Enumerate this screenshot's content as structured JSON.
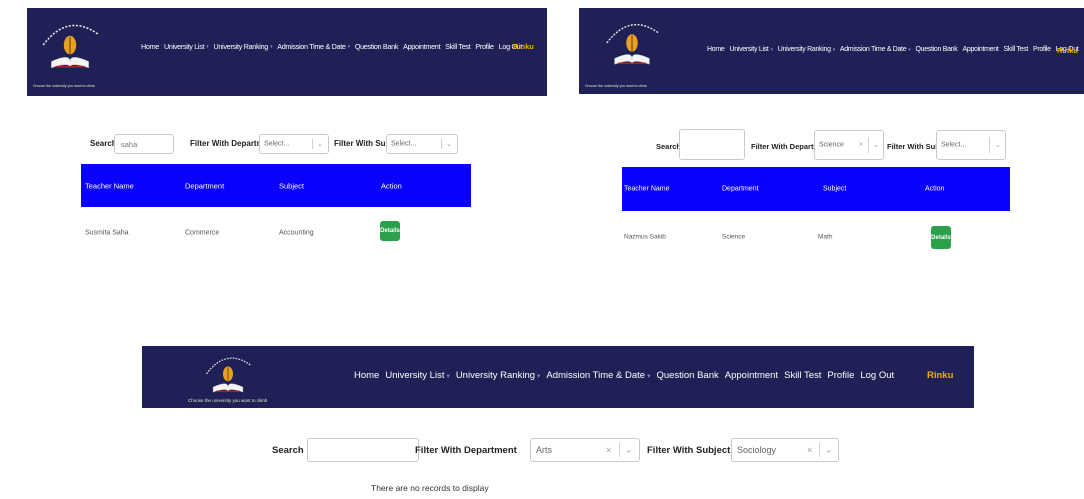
{
  "nav": {
    "tagline": "Choose the university you want to climb",
    "user": "Rinku",
    "menu": [
      {
        "label": "Home",
        "caret": false
      },
      {
        "label": "University List",
        "caret": true
      },
      {
        "label": "University Ranking",
        "caret": true
      },
      {
        "label": "Admission Time & Date",
        "caret": true
      },
      {
        "label": "Question Bank",
        "caret": false
      },
      {
        "label": "Appointment",
        "caret": false
      },
      {
        "label": "Skill Test",
        "caret": false
      },
      {
        "label": "Profile",
        "caret": false
      },
      {
        "label": "Log Out",
        "caret": false
      }
    ]
  },
  "filters": {
    "search_label": "Search",
    "department_label": "Filter With Department",
    "subject_label": "Filter With Subject",
    "select_placeholder": "Select..."
  },
  "table": {
    "col_teacher": "Teacher Name",
    "col_department": "Department",
    "col_subject": "Subject",
    "col_action": "Action",
    "details_label": "Details",
    "empty_message": "There are no records to display"
  },
  "panel1": {
    "search_value": "saha",
    "department_value": "Select...",
    "subject_value": "Select...",
    "row": {
      "teacher": "Susmita Saha",
      "department": "Commerce",
      "subject": "Accounting"
    }
  },
  "panel2": {
    "search_value": "",
    "department_value": "Science",
    "subject_value": "Select...",
    "row": {
      "teacher": "Nazmus Sakib",
      "department": "Science",
      "subject": "Math"
    }
  },
  "panel3": {
    "search_value": "",
    "department_value": "Arts",
    "subject_value": "Sociology"
  },
  "colors": {
    "navbar": "#1f2156",
    "table_header": "#0a00ff",
    "details_button": "#2aa14a",
    "user_name": "#f3b000"
  }
}
